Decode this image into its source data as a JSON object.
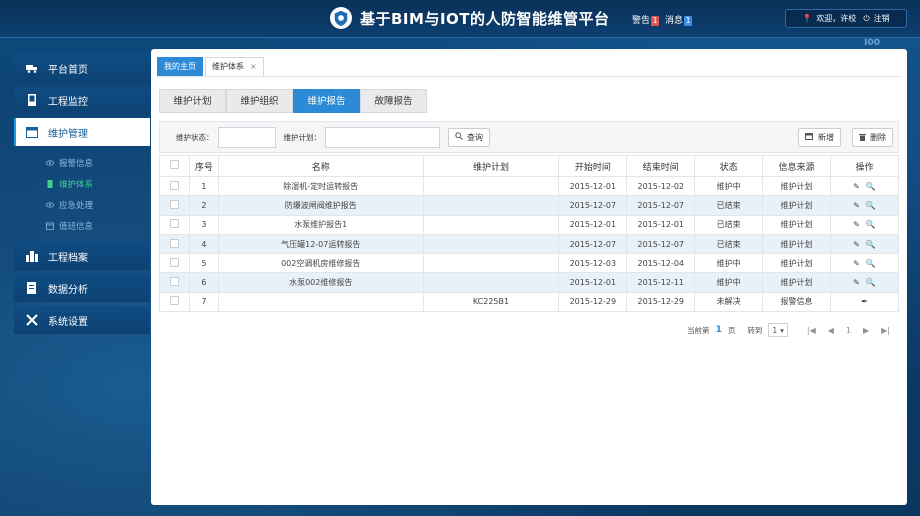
{
  "header": {
    "title": "基于BIM与IOT的人防智能维管平台",
    "alert_label": "警告",
    "alert_count": "1",
    "message_label": "消息",
    "message_count": "1",
    "welcome": "欢迎，许校",
    "logout": "注销",
    "corner_text": "I00"
  },
  "sidebar": {
    "items": [
      {
        "label": "平台首页",
        "icon": "truck-icon"
      },
      {
        "label": "工程监控",
        "icon": "device-icon"
      },
      {
        "label": "维护管理",
        "icon": "window-icon"
      },
      {
        "label": "工程档案",
        "icon": "building-icon"
      },
      {
        "label": "数据分析",
        "icon": "report-icon"
      },
      {
        "label": "系统设置",
        "icon": "tools-icon"
      }
    ],
    "submenu": [
      {
        "label": "报警信息"
      },
      {
        "label": "维护体系"
      },
      {
        "label": "应急处理"
      },
      {
        "label": "值班信息"
      }
    ]
  },
  "tabs": {
    "home": "我的主页",
    "current": "维护体系",
    "close": "×"
  },
  "subtabs": [
    "维护计划",
    "维护组织",
    "维护报告",
    "故障报告"
  ],
  "toolbar": {
    "status_label": "维护状态：",
    "plan_label": "维护计划：",
    "search_label": "查询",
    "add_label": "新增",
    "delete_label": "删除"
  },
  "table": {
    "headers": [
      "序号",
      "名称",
      "维护计划",
      "开始时间",
      "结束时间",
      "状态",
      "信息来源",
      "操作"
    ],
    "rows": [
      {
        "no": "1",
        "name": "除湿机-定时运转报告",
        "plan": "",
        "start": "2015-12-01",
        "end": "2015-12-02",
        "status": "维护中",
        "source": "维护计划"
      },
      {
        "no": "2",
        "name": "防爆波闸阀维护报告",
        "plan": "",
        "start": "2015-12-07",
        "end": "2015-12-07",
        "status": "已结束",
        "source": "维护计划"
      },
      {
        "no": "3",
        "name": "水泵维护报告1",
        "plan": "",
        "start": "2015-12-01",
        "end": "2015-12-01",
        "status": "已结束",
        "source": "维护计划"
      },
      {
        "no": "4",
        "name": "气压罐12-07运转报告",
        "plan": "",
        "start": "2015-12-07",
        "end": "2015-12-07",
        "status": "已结束",
        "source": "维护计划"
      },
      {
        "no": "5",
        "name": "002空调机房维修报告",
        "plan": "",
        "start": "2015-12-03",
        "end": "2015-12-04",
        "status": "维护中",
        "source": "维护计划"
      },
      {
        "no": "6",
        "name": "水泵002维修报告",
        "plan": "",
        "start": "2015-12-01",
        "end": "2015-12-11",
        "status": "维护中",
        "source": "维护计划"
      },
      {
        "no": "7",
        "name": "",
        "plan": "KC225B1",
        "start": "2015-12-29",
        "end": "2015-12-29",
        "status": "未解决",
        "source": "报警信息"
      }
    ]
  },
  "pager": {
    "current_prefix": "当前第",
    "current_page": "1",
    "page_suffix": "页",
    "goto_label": "转到",
    "goto_value": "1",
    "page_number": "1"
  },
  "colors": {
    "accent": "#2c8ad6",
    "alert": "#d9534f",
    "active_sub": "#3fd18a"
  }
}
